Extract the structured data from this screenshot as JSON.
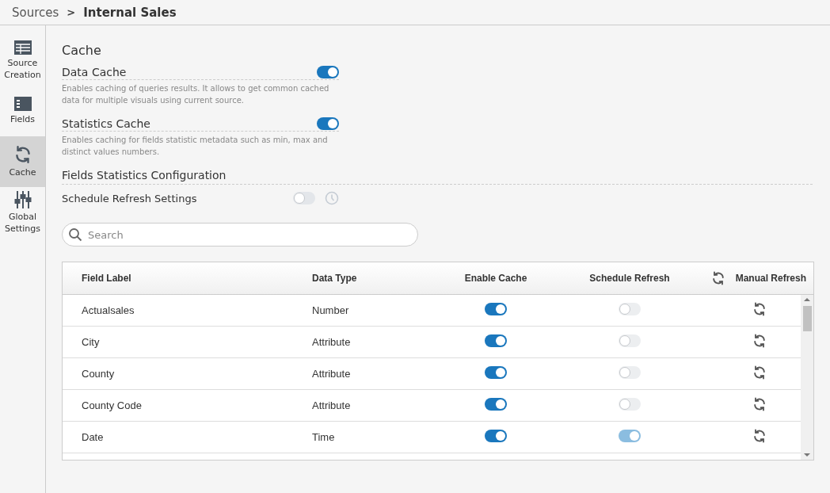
{
  "breadcrumb": {
    "parent": "Sources",
    "separator": ">",
    "current": "Internal Sales"
  },
  "sidebar": {
    "items": [
      {
        "label": "Source Creation",
        "kind": "table",
        "selected": false
      },
      {
        "label": "Fields",
        "kind": "fields",
        "selected": false
      },
      {
        "label": "Cache",
        "kind": "cache",
        "selected": true
      },
      {
        "label": "Global Settings",
        "kind": "sliders",
        "selected": false
      }
    ]
  },
  "title": "Cache",
  "settings": [
    {
      "label": "Data Cache",
      "on": true,
      "description": "Enables caching of queries results. It allows to get common cached data for multiple visuals using current source."
    },
    {
      "label": "Statistics Cache",
      "on": true,
      "description": "Enables caching for fields statistic metadata such as min, max and distinct values numbers."
    }
  ],
  "fields_statistics": {
    "title": "Fields Statistics Configuration",
    "schedule_label": "Schedule Refresh Settings",
    "schedule_on": false
  },
  "search": {
    "placeholder": "Search"
  },
  "table": {
    "columns": [
      "Field Label",
      "Data Type",
      "Enable Cache",
      "Schedule Refresh",
      "Manual Refresh"
    ],
    "rows": [
      {
        "label": "Actualsales",
        "type": "Number",
        "enable_cache": true,
        "schedule_refresh": false
      },
      {
        "label": "City",
        "type": "Attribute",
        "enable_cache": true,
        "schedule_refresh": false
      },
      {
        "label": "County",
        "type": "Attribute",
        "enable_cache": true,
        "schedule_refresh": false
      },
      {
        "label": "County Code",
        "type": "Attribute",
        "enable_cache": true,
        "schedule_refresh": false
      },
      {
        "label": "Date",
        "type": "Time",
        "enable_cache": true,
        "schedule_refresh": true
      }
    ]
  }
}
